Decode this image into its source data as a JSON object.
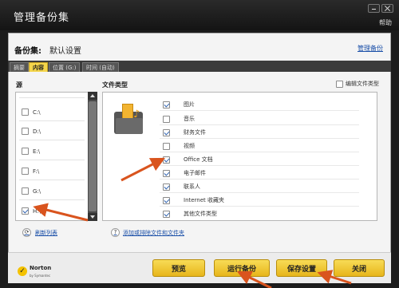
{
  "window": {
    "title": "管理备份集",
    "help": "帮助"
  },
  "backup_set": {
    "label": "备份集:",
    "name": "默认设置",
    "manage_link": "管理备份"
  },
  "tabs": [
    {
      "label": "摘要",
      "active": false
    },
    {
      "label": "内容",
      "active": true
    },
    {
      "label": "位置 (G:)",
      "active": false
    },
    {
      "label": "时间 (自动)",
      "active": false
    }
  ],
  "drives_panel": {
    "title": "源",
    "items": [
      {
        "label": "C:\\",
        "checked": false
      },
      {
        "label": "D:\\",
        "checked": false
      },
      {
        "label": "E:\\",
        "checked": false
      },
      {
        "label": "F:\\",
        "checked": false
      },
      {
        "label": "G:\\",
        "checked": false
      },
      {
        "label": "H:\\",
        "checked": true
      }
    ],
    "refresh_link": "刷新列表"
  },
  "file_types_panel": {
    "title": "文件类型",
    "compare_label": "编辑文件类型",
    "items": [
      {
        "label": "图片",
        "checked": true
      },
      {
        "label": "音乐",
        "checked": false
      },
      {
        "label": "财务文件",
        "checked": true
      },
      {
        "label": "视频",
        "checked": false
      },
      {
        "label": "Office 文档",
        "checked": true
      },
      {
        "label": "电子邮件",
        "checked": true
      },
      {
        "label": "联系人",
        "checked": true
      },
      {
        "label": "Internet 收藏夹",
        "checked": true
      },
      {
        "label": "其他文件类型",
        "checked": true
      }
    ],
    "add_link": "添加或排除文件和文件夹"
  },
  "footer": {
    "brand": "Norton",
    "brand_sub": "by Symantec",
    "buttons": {
      "preview": "预览",
      "run": "运行备份",
      "save": "保存设置",
      "close": "关闭"
    }
  },
  "colors": {
    "accent_yellow": "#f4d54a",
    "annotation_red": "#d9541e",
    "link_blue": "#1a4fa8"
  }
}
